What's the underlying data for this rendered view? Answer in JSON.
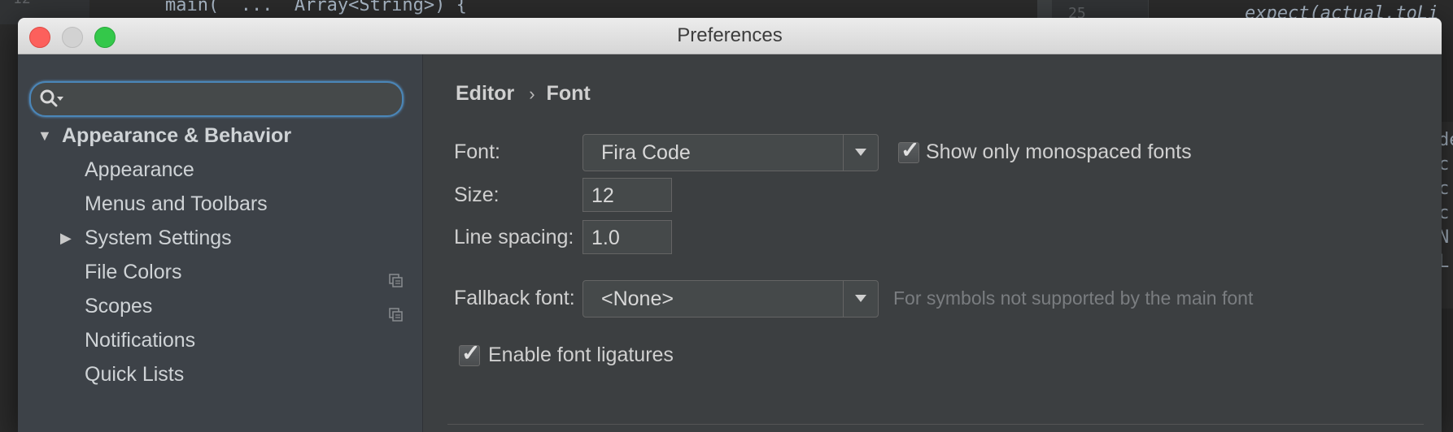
{
  "background": {
    "left_line_number": "12",
    "left_code": "    main(  ...  Array<String>) {",
    "right_line_number": "25",
    "right_code": "expect(actual.toLi",
    "side_letters": [
      "de",
      "c",
      "c",
      "c",
      "N",
      "L"
    ]
  },
  "window": {
    "title": "Preferences"
  },
  "search": {
    "placeholder": "",
    "value": ""
  },
  "sidebar": {
    "items": [
      {
        "label": "Appearance & Behavior",
        "arrow": "▼",
        "bold": true
      },
      {
        "label": "Appearance"
      },
      {
        "label": "Menus and Toolbars"
      },
      {
        "label": "System Settings",
        "arrow": "▶"
      },
      {
        "label": "File Colors",
        "icon": "copy-icon"
      },
      {
        "label": "Scopes",
        "icon": "copy-icon"
      },
      {
        "label": "Notifications"
      },
      {
        "label": "Quick Lists"
      }
    ]
  },
  "breadcrumb": {
    "parent": "Editor",
    "separator": "›",
    "current": "Font"
  },
  "form": {
    "font_label": "Font:",
    "font_value": "Fira Code",
    "monospaced_label": "Show only monospaced fonts",
    "monospaced_checked": true,
    "size_label": "Size:",
    "size_value": "12",
    "line_spacing_label": "Line spacing:",
    "line_spacing_value": "1.0",
    "fallback_label": "Fallback font:",
    "fallback_value": "<None>",
    "fallback_hint": "For symbols not supported by the main font",
    "ligatures_label": "Enable font ligatures",
    "ligatures_checked": true
  },
  "colors": {
    "search_focus": "#4a86b8",
    "close": "#fc605c",
    "minimize": "#d2d2d2",
    "maximize": "#34c84a"
  }
}
